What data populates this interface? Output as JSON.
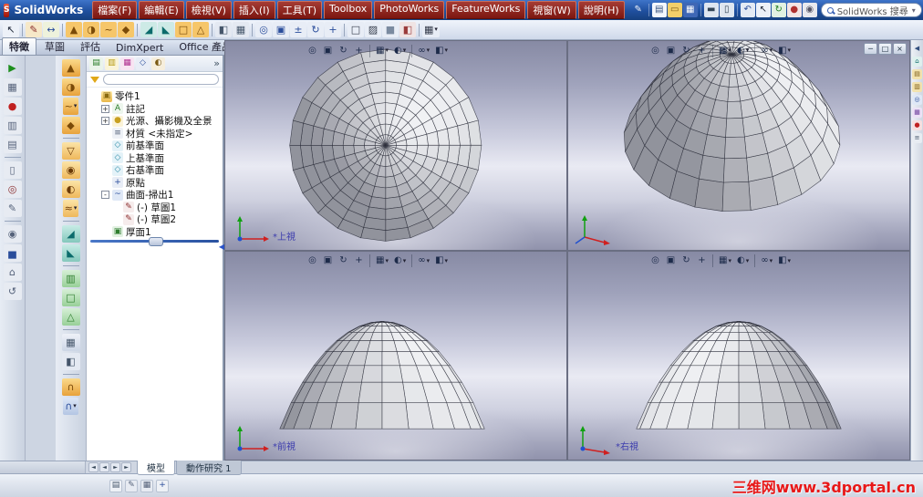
{
  "window": {
    "logo_text": "SolidWorks",
    "search_value": "SolidWorks 搜尋",
    "help_label": "?"
  },
  "menus": [
    "檔案(F)",
    "編輯(E)",
    "檢視(V)",
    "插入(I)",
    "工具(T)",
    "Toolbox",
    "PhotoWorks",
    "FeatureWorks",
    "視窗(W)",
    "說明(H)"
  ],
  "std_toolbar": [
    "quill-icon",
    "|",
    "new-icon",
    "open-icon",
    "save-icon",
    "|",
    "print-icon",
    "print-preview-icon",
    "|",
    "undo-icon",
    "select-arrow-icon",
    "rebuild-icon",
    "appearance-icon",
    "options-icon"
  ],
  "view_toolbar": [
    "select-arrow-icon",
    "|",
    "sketch-icon",
    "smart-dimension-icon",
    "|",
    "extrude-boss-icon",
    "revolve-boss-icon",
    "sweep-icon",
    "loft-icon",
    "|",
    "fillet-icon",
    "chamfer-icon",
    "shell-icon",
    "draft-icon",
    "|",
    "mirror-feature-icon",
    "linear-pattern-icon",
    "|",
    "zoom-fit-icon",
    "zoom-area-icon",
    "zoom-inout-icon",
    "rotate-view-icon",
    "pan-icon",
    "|",
    "wireframe-icon",
    "hidden-lines-icon",
    "shaded-icon",
    "section-view-icon",
    "|",
    "view-orientation-icon*"
  ],
  "cmd_tabs": {
    "active_index": 0,
    "items": [
      "特徵",
      "草圖",
      "評估",
      "DimXpert",
      "Office 產品"
    ]
  },
  "left_toolbar": [
    "play-icon",
    "grid-icon",
    "record-icon",
    "panel-icon",
    "film-icon",
    "|",
    "clipboard-icon",
    "target-icon",
    "pen-icon",
    "|",
    "gear-icon",
    "chart-icon",
    "home-icon",
    "loop-icon"
  ],
  "features_toolbar": [
    "boss-extrude-icon",
    "revolved-boss-icon",
    "swept-boss-icon*",
    "lofted-boss-icon",
    "|",
    "extruded-cut-icon",
    "hole-wizard-icon",
    "revolved-cut-icon",
    "swept-cut-icon*",
    "|",
    "fillet-feature-icon",
    "chamfer-feature-icon",
    "|",
    "rib-feature-icon",
    "shell-feature-icon",
    "draft-feature-icon",
    "|",
    "linear-pattern-feature-icon",
    "mirror-feature-icon",
    "|",
    "wrap-icon",
    "dome-icon*"
  ],
  "panel_toolbar": {
    "icons": [
      "featuremanager-icon",
      "propertymanager-icon",
      "configurationmanager-icon",
      "dimxpertmanager-icon",
      "displaymanager-icon"
    ],
    "more_label": "»"
  },
  "feature_tree": {
    "items": [
      {
        "label": "零件1",
        "icon": "part-icon",
        "level": 0,
        "toggle": null
      },
      {
        "label": "註記",
        "icon": "annotations-icon",
        "level": 1,
        "toggle": "+"
      },
      {
        "label": "光源、攝影機及全景",
        "icon": "lights-icon",
        "level": 1,
        "toggle": "+"
      },
      {
        "label": "材質 <未指定>",
        "icon": "material-icon",
        "level": 1,
        "toggle": null
      },
      {
        "label": "前基準面",
        "icon": "plane-icon",
        "level": 1,
        "toggle": null
      },
      {
        "label": "上基準面",
        "icon": "plane-icon",
        "level": 1,
        "toggle": null
      },
      {
        "label": "右基準面",
        "icon": "plane-icon",
        "level": 1,
        "toggle": null
      },
      {
        "label": "原點",
        "icon": "origin-icon",
        "level": 1,
        "toggle": null
      },
      {
        "label": "曲面-掃出1",
        "icon": "surface-sweep-icon",
        "level": 1,
        "toggle": "-"
      },
      {
        "label": "(-) 草圖1",
        "icon": "sketch-tree-icon",
        "level": 2,
        "toggle": null
      },
      {
        "label": "(-) 草圖2",
        "icon": "sketch-tree-icon",
        "level": 2,
        "toggle": null
      },
      {
        "label": "厚面1",
        "icon": "thicken-icon",
        "level": 1,
        "toggle": null
      }
    ]
  },
  "viewport_toolbar": [
    "zoom-fit-icon",
    "zoom-area-icon",
    "rotate-view-icon",
    "pan-icon",
    "|",
    "view-orientation-icon*",
    "display-style-icon*",
    "|",
    "hide-show-items-icon*",
    "section-view-icon*"
  ],
  "viewports": {
    "top": {
      "label": "*上視"
    },
    "iso": {
      "label": ""
    },
    "front": {
      "label": "*前視"
    },
    "right": {
      "label": "*右視"
    }
  },
  "window_controls": {
    "minimize": "─",
    "restore": "□",
    "close": "×"
  },
  "task_pane": [
    "collapse-icon",
    "resources-home-icon",
    "design-library-icon",
    "file-explorer-icon",
    "search-icon",
    "view-palette-icon",
    "appearances-icon",
    "custom-properties-icon"
  ],
  "doc_tabs": {
    "active_index": 0,
    "items": [
      "模型",
      "動作研究 1"
    ],
    "nav": [
      "first-tab-icon",
      "prev-tab-icon",
      "next-tab-icon",
      "last-tab-icon"
    ]
  },
  "status_bar": {
    "icons": [
      "sheet-icon",
      "pen-icon",
      "grid-icon",
      "axis-icon"
    ],
    "watermark": "三维网www.3dportal.cn"
  }
}
